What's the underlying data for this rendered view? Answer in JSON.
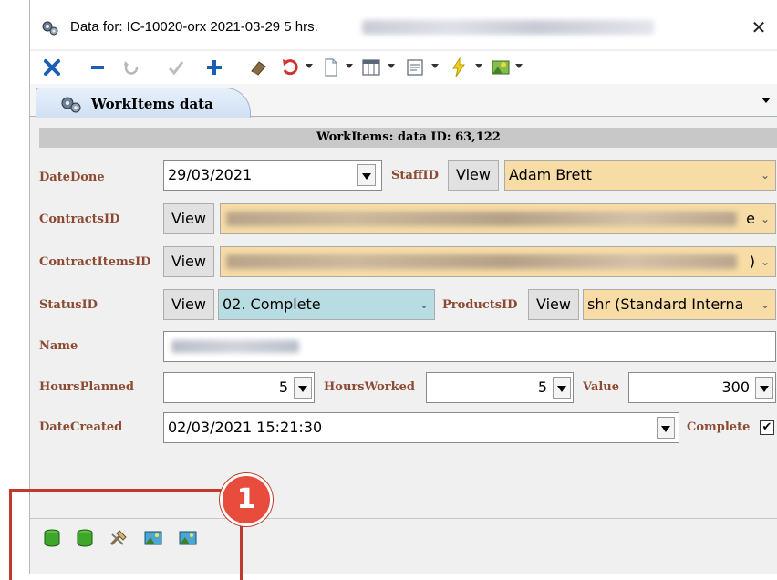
{
  "window": {
    "title": "Data for: IC-10020-orx 2021-03-29 5 hrs.",
    "close_glyph": "✕"
  },
  "toolbar": {
    "icons": [
      "close-red-x-icon",
      "minus-icon",
      "refresh-icon",
      "check-icon",
      "add-icon",
      "eraser-icon",
      "undo-icon",
      "new-document-icon",
      "columns-icon",
      "form-icon",
      "lightning-icon",
      "image-icon"
    ]
  },
  "tab": {
    "label": "WorkItems data"
  },
  "form": {
    "header": "WorkItems: data ID: 63,122",
    "view_label": "View",
    "fields": {
      "date_done": {
        "label": "DateDone",
        "value": "29/03/2021"
      },
      "staff_id": {
        "label": "StaffID",
        "value": "Adam Brett"
      },
      "contracts_id": {
        "label": "ContractsID",
        "trailing_text": "e"
      },
      "contract_items_id": {
        "label": "ContractItemsID",
        "trailing_text": ")"
      },
      "status_id": {
        "label": "StatusID",
        "value": "02. Complete"
      },
      "products_id": {
        "label": "ProductsID",
        "value": "shr (Standard Interna"
      },
      "name": {
        "label": "Name"
      },
      "hours_planned": {
        "label": "HoursPlanned",
        "value": "5"
      },
      "hours_worked": {
        "label": "HoursWorked",
        "value": "5"
      },
      "value": {
        "label": "Value",
        "value": "300"
      },
      "date_created": {
        "label": "DateCreated",
        "value": "02/03/2021 15:21:30"
      },
      "complete": {
        "label": "Complete",
        "checked": true,
        "check_glyph": "✔"
      }
    }
  },
  "footer": {
    "icons": [
      "database-green-icon",
      "database-green-icon",
      "tools-icon",
      "image-export-icon",
      "image-import-icon"
    ]
  },
  "annotation": {
    "badge_number": "1"
  },
  "colors": {
    "label_text": "#8c4a33",
    "staff_bg": "#f7dca6",
    "status_bg": "#b7dde3",
    "products_bg": "#f7dca6",
    "annotation_red": "#e74c3c"
  }
}
